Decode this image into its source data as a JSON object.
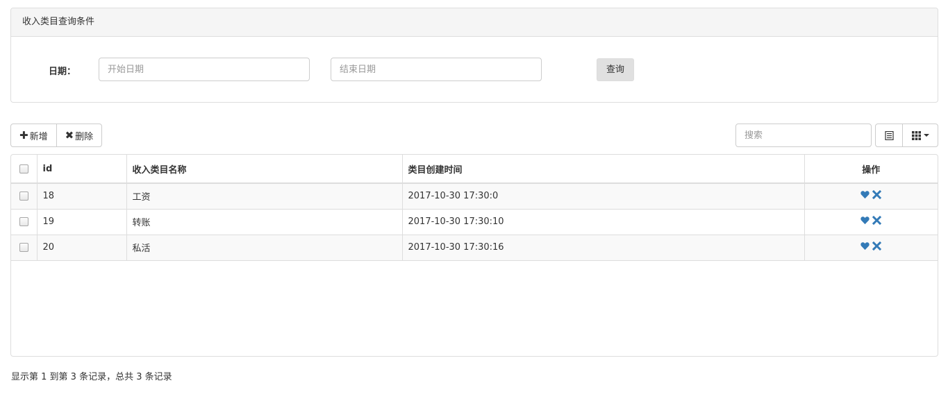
{
  "query_panel": {
    "title": "收入类目查询条件",
    "date_label": "日期：",
    "start_placeholder": "开始日期",
    "end_placeholder": "结束日期",
    "query_button": "查询"
  },
  "toolbar": {
    "add_label": "新增",
    "delete_label": "删除",
    "add_glyph": "✚",
    "delete_glyph": "✖",
    "search_placeholder": "搜索"
  },
  "table": {
    "columns": {
      "id": "id",
      "name": "收入类目名称",
      "created": "类目创建时间",
      "ops": "操作"
    },
    "rows": [
      {
        "id": "18",
        "name": "工资",
        "created": "2017-10-30 17:30:0"
      },
      {
        "id": "19",
        "name": "转账",
        "created": "2017-10-30 17:30:10"
      },
      {
        "id": "20",
        "name": "私活",
        "created": "2017-10-30 17:30:16"
      }
    ]
  },
  "footer": {
    "pagination_info": "显示第 1 到第 3 条记录，总共 3 条记录"
  },
  "colors": {
    "action_icon": "#337ab7",
    "border": "#dddddd",
    "panel_heading_bg": "#f5f5f5"
  },
  "icons": {
    "like": "heart-icon",
    "remove": "x-icon",
    "toggle": "list-view-icon",
    "columns": "grid-icon"
  }
}
